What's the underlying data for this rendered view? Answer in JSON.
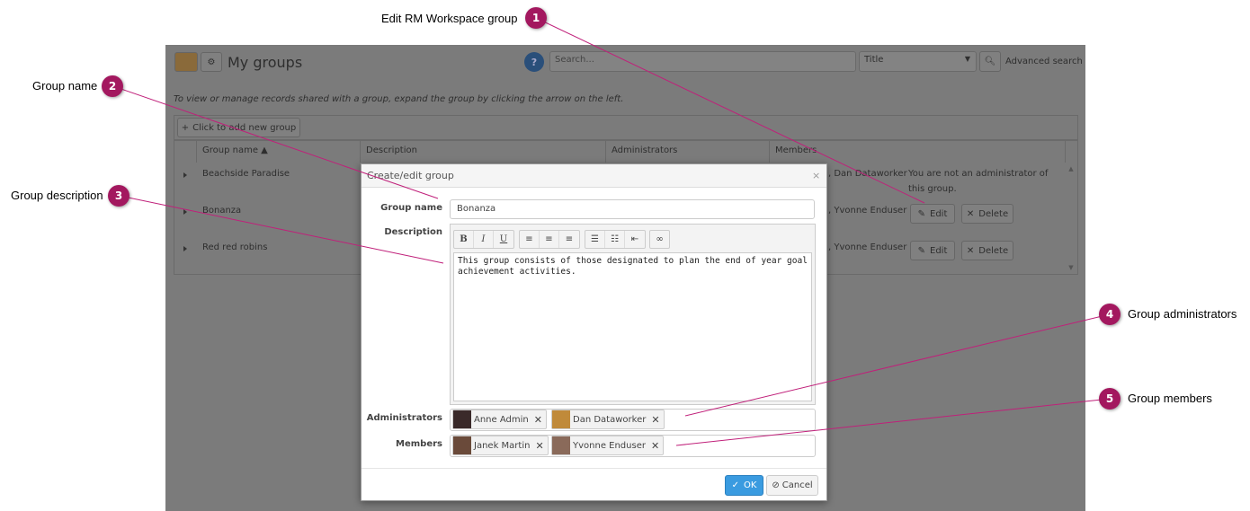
{
  "page": {
    "title": "My groups",
    "help_icon": "question-icon",
    "search_placeholder": "Search...",
    "search_field": "Title",
    "advanced_search": "Advanced search",
    "hint": "To view or manage records shared with a group, expand the group by clicking the arrow on the left.",
    "add_group": "Click to add new group"
  },
  "table": {
    "columns": [
      "Group name ▲",
      "Description",
      "Administrators",
      "Members"
    ],
    "rows": [
      {
        "name": "Beachside Paradise",
        "admins": ", Dan Dataworker",
        "note": "You are not an administrator of this group."
      },
      {
        "name": "Bonanza",
        "admins": ", Yvonne Enduser",
        "edit": "Edit",
        "delete": "Delete"
      },
      {
        "name": "Red red robins",
        "admins": ", Yvonne Enduser",
        "edit": "Edit",
        "delete": "Delete"
      }
    ]
  },
  "dialog": {
    "title": "Create/edit group",
    "close": "×",
    "group_name_label": "Group name",
    "group_name": "Bonanza",
    "description_label": "Description",
    "toolbar": [
      "B",
      "I",
      "U"
    ],
    "description": "This group consists of those designated to plan the end of year goal achievement activities.",
    "administrators_label": "Administrators",
    "administrators": [
      "Anne Admin",
      "Dan Dataworker"
    ],
    "members_label": "Members",
    "members": [
      "Janek Martin",
      "Yvonne Enduser"
    ],
    "ok": "OK",
    "cancel": "Cancel"
  },
  "callouts": [
    {
      "n": "1",
      "text": "Edit RM Workspace group"
    },
    {
      "n": "2",
      "text": "Group name"
    },
    {
      "n": "3",
      "text": "Group description"
    },
    {
      "n": "4",
      "text": "Group administrators"
    },
    {
      "n": "5",
      "text": "Group members"
    }
  ],
  "colors": {
    "callout": "#a3185f",
    "overlay": "#7b7b7b",
    "ok": "#3a9be0"
  }
}
